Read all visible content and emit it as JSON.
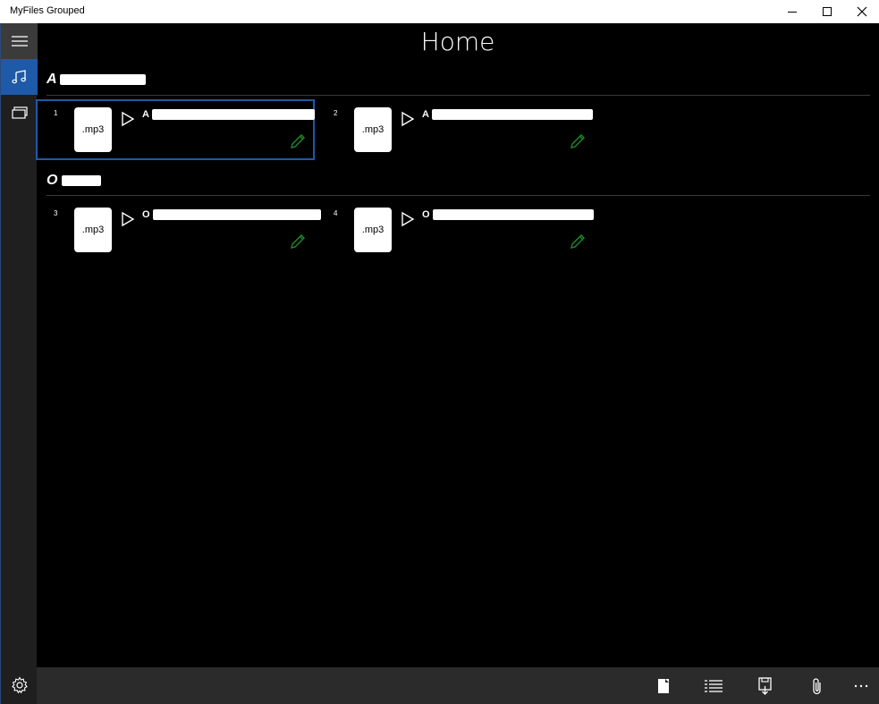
{
  "window": {
    "title": "MyFiles Grouped",
    "controls": [
      "minimize-icon",
      "maximize-icon",
      "close-icon"
    ]
  },
  "nav": {
    "items": [
      {
        "icon": "hamburger-menu-icon",
        "selected": false
      },
      {
        "icon": "music-note-icon",
        "selected": true
      },
      {
        "icon": "gallery-icon",
        "selected": false
      }
    ],
    "footer": {
      "icon": "settings-gear-icon"
    }
  },
  "page": {
    "title": "Home"
  },
  "groups": [
    {
      "header": "A",
      "items": [
        {
          "number": "1",
          "type": ".mp3",
          "name": "A",
          "selected": true
        },
        {
          "number": "2",
          "type": ".mp3",
          "name": "A",
          "selected": false
        }
      ]
    },
    {
      "header": "O",
      "items": [
        {
          "number": "3",
          "type": ".mp3",
          "name": "O",
          "selected": false
        },
        {
          "number": "4",
          "type": ".mp3",
          "name": "O",
          "selected": false
        }
      ]
    }
  ],
  "commandbar": {
    "buttons": [
      "new-file-icon",
      "list-view-icon",
      "save-icon",
      "attach-icon",
      "more-icon"
    ]
  },
  "colors": {
    "accent": "#1e5aa8",
    "edit_icon": "#1f8a2a",
    "background": "#000000",
    "rail": "#1f1f1f",
    "commandbar": "#2b2b2b"
  }
}
